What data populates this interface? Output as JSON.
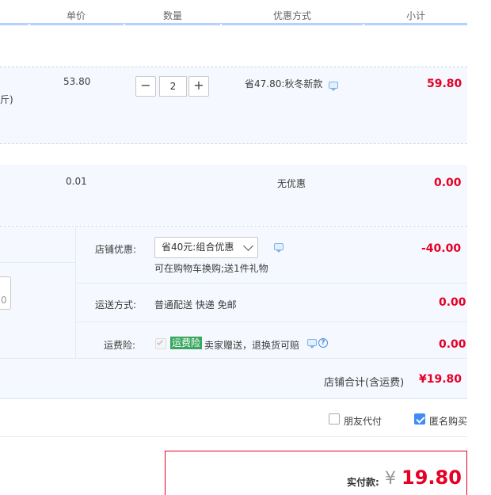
{
  "header": {
    "col_price": "单价",
    "col_qty": "数量",
    "col_discount": "优惠方式",
    "col_subtotal": "小计"
  },
  "item1": {
    "price": "53.80",
    "left_fragment": "斤)",
    "qty_minus": "−",
    "qty_value": "2",
    "qty_plus": "+",
    "discount": "省47.80:秋冬新款",
    "subtotal": "59.80"
  },
  "item2": {
    "price": "0.01",
    "discount": "无优惠",
    "subtotal": "0.00"
  },
  "shop": {
    "left_fragment": "0",
    "promo_label": "店铺优惠:",
    "promo_selected": "省40元:组合优惠",
    "promo_note": "可在购物车换购;送1件礼物",
    "promo_amount": "-40.00",
    "shipping_label": "运送方式:",
    "shipping_value": "普通配送 快递 免邮",
    "shipping_amount": "0.00",
    "insurance_label": "运费险:",
    "insurance_tag": "运费险",
    "insurance_text": "卖家赠送，退换货可赔",
    "insurance_amount": "0.00",
    "total_label": "店铺合计(含运费)",
    "total_value": "¥19.80"
  },
  "options": {
    "friend_pay": "朋友代付",
    "friend_pay_checked": false,
    "anonymous": "匿名购买",
    "anonymous_checked": true
  },
  "payment": {
    "label": "实付款:",
    "currency": "¥",
    "amount": "19.80"
  },
  "colors": {
    "accent_red": "#e60026",
    "accent_blue": "#3d8df5",
    "row_bg": "#f5f8fe",
    "header_line": "#b2d1ff"
  }
}
